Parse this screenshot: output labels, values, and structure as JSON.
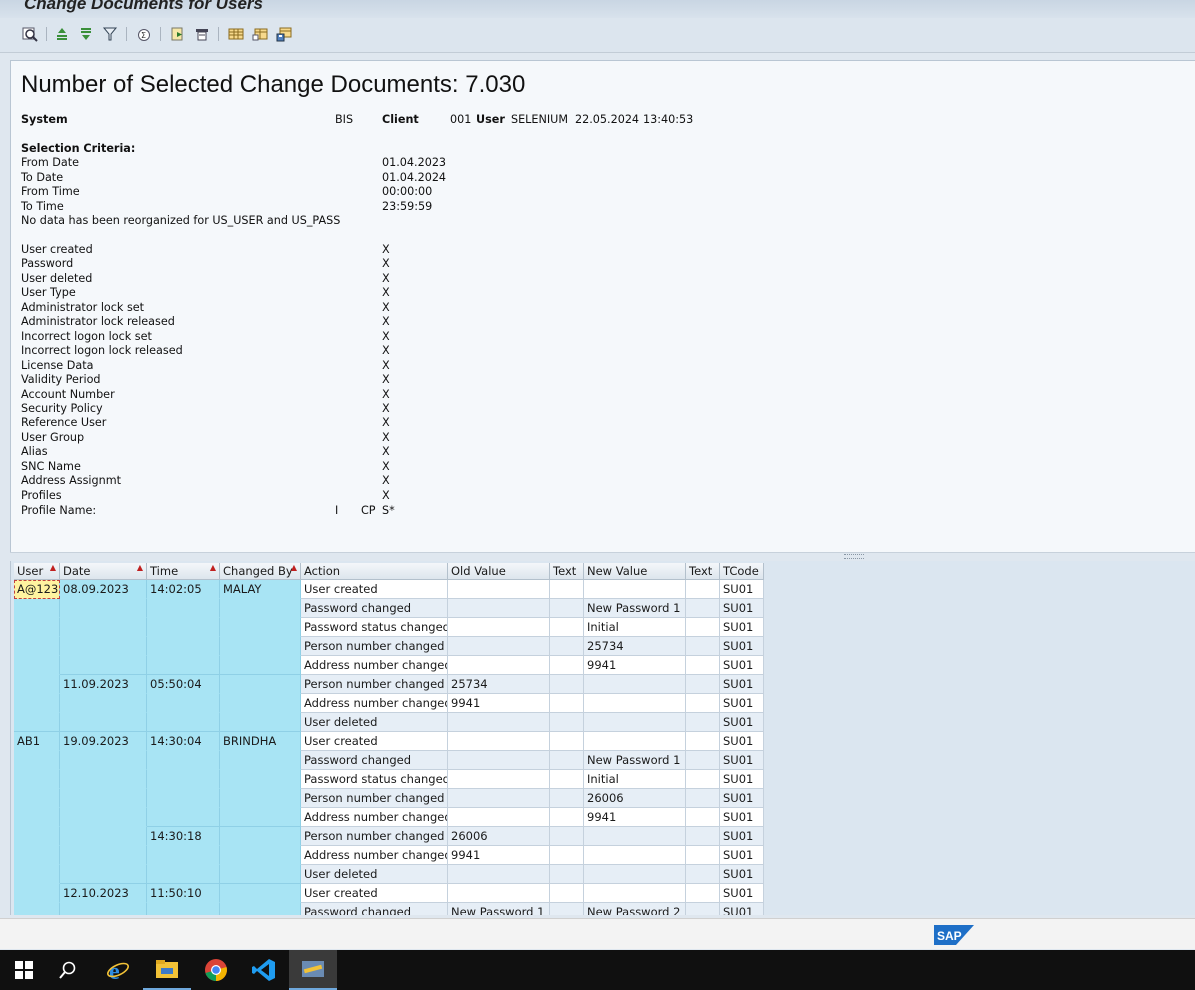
{
  "window": {
    "title": "Change Documents for Users"
  },
  "toolbar": {
    "icons": [
      "display-details-icon",
      "sort-ascending-icon",
      "sort-descending-icon",
      "filter-icon",
      "totals-icon",
      "export-icon",
      "print-icon",
      "layout-icon",
      "choose-layout-icon",
      "save-layout-icon"
    ]
  },
  "header": {
    "title": "Number of Selected Change Documents: 7.030",
    "system_label": "System",
    "system_value": "BIS",
    "client_label": "Client",
    "client_value": "001",
    "user_label": "User",
    "user_value": "SELENIUM",
    "date": "22.05.2024",
    "time": "13:40:53",
    "selection_criteria": "Selection Criteria:",
    "criteria": [
      {
        "label": "From Date",
        "value": "01.04.2023"
      },
      {
        "label": "To Date",
        "value": "01.04.2024"
      },
      {
        "label": "From Time",
        "value": "00:00:00"
      },
      {
        "label": "To Time",
        "value": "23:59:59"
      }
    ],
    "reorg_note": "No data has been reorganized for US_USER and US_PASS",
    "flags": [
      {
        "label": "User created",
        "value": "X"
      },
      {
        "label": "Password",
        "value": "X"
      },
      {
        "label": "User deleted",
        "value": "X"
      },
      {
        "label": "User Type",
        "value": "X"
      },
      {
        "label": "Administrator lock set",
        "value": "X"
      },
      {
        "label": "Administrator lock released",
        "value": "X"
      },
      {
        "label": "Incorrect logon lock set",
        "value": "X"
      },
      {
        "label": "Incorrect logon lock released",
        "value": "X"
      },
      {
        "label": "License Data",
        "value": "X"
      },
      {
        "label": "Validity Period",
        "value": "X"
      },
      {
        "label": "Account Number",
        "value": "X"
      },
      {
        "label": "Security Policy",
        "value": "X"
      },
      {
        "label": "Reference User",
        "value": "X"
      },
      {
        "label": "User Group",
        "value": "X"
      },
      {
        "label": "Alias",
        "value": "X"
      },
      {
        "label": "SNC Name",
        "value": "X"
      },
      {
        "label": "Address Assignmt",
        "value": "X"
      },
      {
        "label": "Profiles",
        "value": "X"
      }
    ],
    "profile_label": "Profile Name:",
    "profile_i": "I",
    "profile_cp": "CP",
    "profile_value": "S*"
  },
  "grid": {
    "columns": [
      "User",
      "Date",
      "Time",
      "Changed By",
      "Action",
      "Old Value",
      "Text",
      "New Value",
      "Text",
      "TCode"
    ],
    "rows": [
      {
        "user": "A@123",
        "date": "08.09.2023",
        "time": "14:02:05",
        "changed_by": "MALAY",
        "action": "User created",
        "old_value": "",
        "text1": "",
        "new_value": "",
        "text2": "",
        "tcode": "SU01"
      },
      {
        "user": "",
        "date": "",
        "time": "",
        "changed_by": "",
        "action": "Password changed",
        "old_value": "",
        "text1": "",
        "new_value": "New Password  1",
        "text2": "",
        "tcode": "SU01"
      },
      {
        "user": "",
        "date": "",
        "time": "",
        "changed_by": "",
        "action": "Password status changed",
        "old_value": "",
        "text1": "",
        "new_value": "Initial",
        "text2": "",
        "tcode": "SU01"
      },
      {
        "user": "",
        "date": "",
        "time": "",
        "changed_by": "",
        "action": "Person number changed",
        "old_value": "",
        "text1": "",
        "new_value": "25734",
        "text2": "",
        "tcode": "SU01"
      },
      {
        "user": "",
        "date": "",
        "time": "",
        "changed_by": "",
        "action": "Address number changed",
        "old_value": "",
        "text1": "",
        "new_value": "9941",
        "text2": "",
        "tcode": "SU01"
      },
      {
        "user": "",
        "date": "11.09.2023",
        "time": "05:50:04",
        "changed_by": "",
        "action": "Person number changed",
        "old_value": "25734",
        "text1": "",
        "new_value": "",
        "text2": "",
        "tcode": "SU01"
      },
      {
        "user": "",
        "date": "",
        "time": "",
        "changed_by": "",
        "action": "Address number changed",
        "old_value": "9941",
        "text1": "",
        "new_value": "",
        "text2": "",
        "tcode": "SU01"
      },
      {
        "user": "",
        "date": "",
        "time": "",
        "changed_by": "",
        "action": "User deleted",
        "old_value": "",
        "text1": "",
        "new_value": "",
        "text2": "",
        "tcode": "SU01"
      },
      {
        "user": "AB1",
        "date": "19.09.2023",
        "time": "14:30:04",
        "changed_by": "BRINDHA",
        "action": "User created",
        "old_value": "",
        "text1": "",
        "new_value": "",
        "text2": "",
        "tcode": "SU01"
      },
      {
        "user": "",
        "date": "",
        "time": "",
        "changed_by": "",
        "action": "Password changed",
        "old_value": "",
        "text1": "",
        "new_value": "New Password  1",
        "text2": "",
        "tcode": "SU01"
      },
      {
        "user": "",
        "date": "",
        "time": "",
        "changed_by": "",
        "action": "Password status changed",
        "old_value": "",
        "text1": "",
        "new_value": "Initial",
        "text2": "",
        "tcode": "SU01"
      },
      {
        "user": "",
        "date": "",
        "time": "",
        "changed_by": "",
        "action": "Person number changed",
        "old_value": "",
        "text1": "",
        "new_value": "26006",
        "text2": "",
        "tcode": "SU01"
      },
      {
        "user": "",
        "date": "",
        "time": "",
        "changed_by": "",
        "action": "Address number changed",
        "old_value": "",
        "text1": "",
        "new_value": "9941",
        "text2": "",
        "tcode": "SU01"
      },
      {
        "user": "",
        "date": "",
        "time": "14:30:18",
        "changed_by": "",
        "action": "Person number changed",
        "old_value": "26006",
        "text1": "",
        "new_value": "",
        "text2": "",
        "tcode": "SU01"
      },
      {
        "user": "",
        "date": "",
        "time": "",
        "changed_by": "",
        "action": "Address number changed",
        "old_value": "9941",
        "text1": "",
        "new_value": "",
        "text2": "",
        "tcode": "SU01"
      },
      {
        "user": "",
        "date": "",
        "time": "",
        "changed_by": "",
        "action": "User deleted",
        "old_value": "",
        "text1": "",
        "new_value": "",
        "text2": "",
        "tcode": "SU01"
      },
      {
        "user": "",
        "date": "12.10.2023",
        "time": "11:50:10",
        "changed_by": "",
        "action": "User created",
        "old_value": "",
        "text1": "",
        "new_value": "",
        "text2": "",
        "tcode": "SU01"
      },
      {
        "user": "",
        "date": "",
        "time": "",
        "changed_by": "",
        "action": "Password changed",
        "old_value": "New Password  1",
        "text1": "",
        "new_value": "New Password  2",
        "text2": "",
        "tcode": "SU01"
      }
    ]
  },
  "footer": {
    "logo_text": "SAP"
  },
  "taskbar": {
    "items": [
      "windows-start-icon",
      "search-icon",
      "internet-explorer-icon",
      "file-explorer-icon",
      "chrome-icon",
      "vscode-icon",
      "sap-gui-icon"
    ]
  },
  "colors": {
    "key_cells": "#a8e4f4",
    "selected_cell": "#fff3a0",
    "sort_indicator": "#c02020"
  }
}
